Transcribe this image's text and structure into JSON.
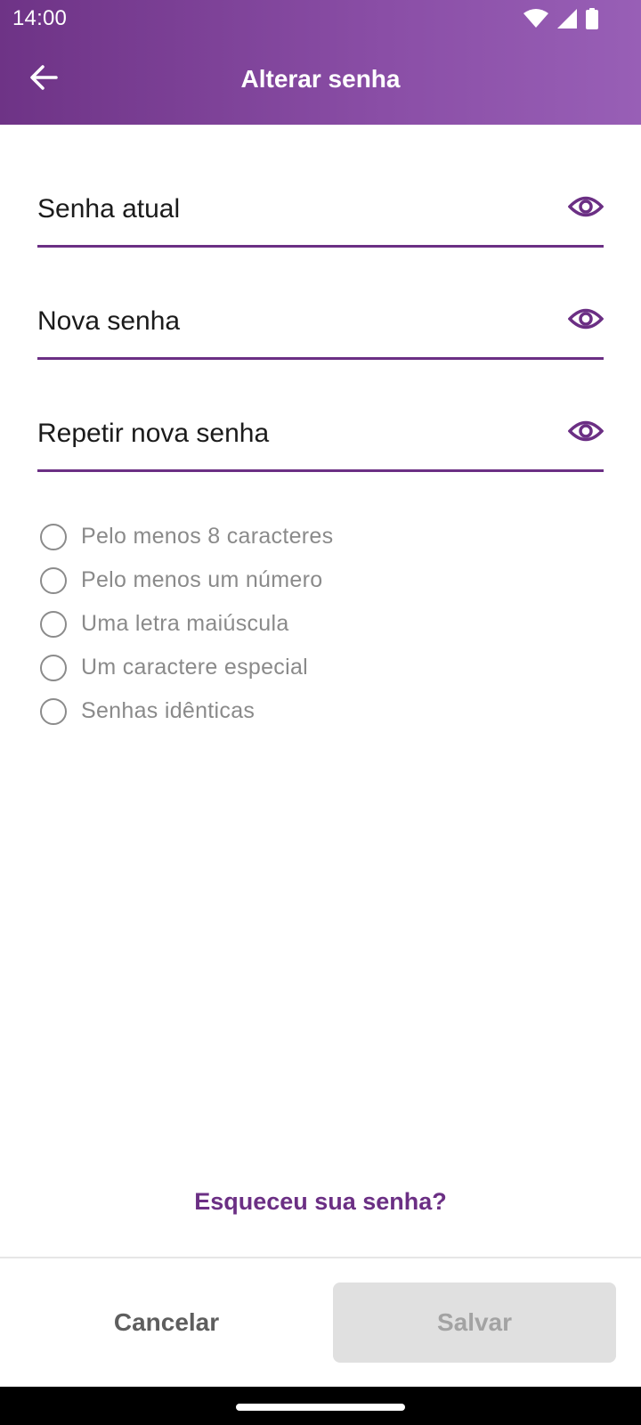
{
  "status_bar": {
    "time": "14:00",
    "icons": [
      "wifi-icon",
      "signal-icon",
      "battery-icon"
    ]
  },
  "app_bar": {
    "title": "Alterar senha",
    "back_icon": "arrow-left-icon"
  },
  "form": {
    "fields": [
      {
        "label": "Senha atual",
        "toggle_icon": "eye-icon"
      },
      {
        "label": "Nova senha",
        "toggle_icon": "eye-icon"
      },
      {
        "label": "Repetir nova senha",
        "toggle_icon": "eye-icon"
      }
    ]
  },
  "requirements": [
    {
      "text": "Pelo menos 8 caracteres",
      "checked": false
    },
    {
      "text": "Pelo menos um número",
      "checked": false
    },
    {
      "text": "Uma letra maiúscula",
      "checked": false
    },
    {
      "text": "Um caractere especial",
      "checked": false
    },
    {
      "text": "Senhas idênticas",
      "checked": false
    }
  ],
  "forgot_link": "Esqueceu sua senha?",
  "actions": {
    "cancel_label": "Cancelar",
    "save_label": "Salvar",
    "save_enabled": false
  },
  "colors": {
    "primary": "#6b2f84",
    "header_gradient_start": "#6e3386",
    "header_gradient_end": "#985fb6",
    "disabled_bg": "#e0e0e0",
    "disabled_text": "#a3a3a3",
    "hint_text": "#8a8a8a"
  }
}
